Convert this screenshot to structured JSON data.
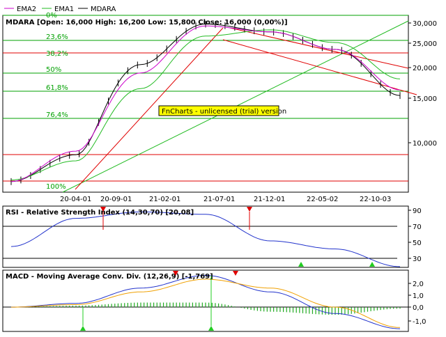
{
  "colors": {
    "background": "#ffffff",
    "frame": "#000000",
    "fib_line": "#00a000",
    "red_line": "#e00000",
    "ema2": "#cc00cc",
    "ema1": "#22bb22",
    "price": "#000000",
    "rsi_line": "#2233cc",
    "macd_line": "#2233cc",
    "signal_line": "#f0a000",
    "histogram": "#22aa22",
    "trial_badge_bg": "#ffff00",
    "marker_red": "#e00000",
    "marker_green": "#22cc22"
  },
  "legend": [
    {
      "name": "EMA2",
      "color": "#cc00cc"
    },
    {
      "name": "EMA1",
      "color": "#22bb22"
    },
    {
      "name": "MDARA",
      "color": "#000000"
    }
  ],
  "price_panel": {
    "title": "MDARA [Open: 16,000  High: 16,200  Low: 15,800  Close: 16,000 (0,00%)]",
    "trial_text": "FnCharts - unlicensed (trial) version",
    "fib_labels": [
      "0%",
      "23,6%",
      "38,2%",
      "50%",
      "61,8%",
      "76,4%",
      "100%"
    ],
    "ytick_labels": [
      "30,000",
      "25,000",
      "20,000",
      "15,000",
      "10,000"
    ]
  },
  "x_labels": [
    "20-04-01",
    "20-09-01",
    "21-02-01",
    "21-07-01",
    "21-12-01",
    "22-05-02",
    "22-10-03"
  ],
  "rsi_panel": {
    "title": "RSI - Relative Strength Index (14,30,70) [20,08]",
    "ytick_labels": [
      "90",
      "70",
      "50",
      "30"
    ]
  },
  "macd_panel": {
    "title": "MACD - Moving Average Conv. Div. (12,26,9) [-1,769]",
    "ytick_labels": [
      "2,0",
      "1,0",
      "0,0",
      "-1,0"
    ]
  },
  "chart_data": [
    {
      "type": "line",
      "panel": "price",
      "x": [
        "20-04-01",
        "20-09-01",
        "21-02-01",
        "21-07-01",
        "21-12-01",
        "22-05-02",
        "22-10-03"
      ],
      "yscale": "log",
      "ylim": [
        7000,
        32000
      ],
      "series": [
        {
          "name": "MDARA",
          "values": [
            7500,
            9500,
            21000,
            30000,
            28000,
            24000,
            16000
          ]
        },
        {
          "name": "EMA1",
          "values": [
            7600,
            9000,
            17000,
            27000,
            28500,
            25500,
            18500
          ]
        },
        {
          "name": "EMA2",
          "values": [
            7500,
            9800,
            19500,
            29500,
            28000,
            24000,
            16800
          ]
        }
      ]
    },
    {
      "type": "line",
      "panel": "rsi",
      "x": [
        "20-04-01",
        "20-09-01",
        "21-02-01",
        "21-07-01",
        "21-12-01",
        "22-05-02",
        "22-10-03"
      ],
      "ylim": [
        20,
        90
      ],
      "series": [
        {
          "name": "RSI",
          "values": [
            45,
            80,
            88,
            85,
            52,
            42,
            20
          ]
        }
      ]
    },
    {
      "type": "line",
      "panel": "macd",
      "x": [
        "20-04-01",
        "20-09-01",
        "21-02-01",
        "21-07-01",
        "21-12-01",
        "22-05-02",
        "22-10-03"
      ],
      "ylim": [
        -1.8,
        2.8
      ],
      "series": [
        {
          "name": "MACD",
          "values": [
            0.0,
            0.3,
            1.5,
            2.5,
            1.2,
            -0.5,
            -1.7
          ]
        },
        {
          "name": "Signal",
          "values": [
            0.0,
            0.2,
            1.2,
            2.2,
            1.5,
            0.0,
            -1.6
          ]
        }
      ]
    }
  ]
}
